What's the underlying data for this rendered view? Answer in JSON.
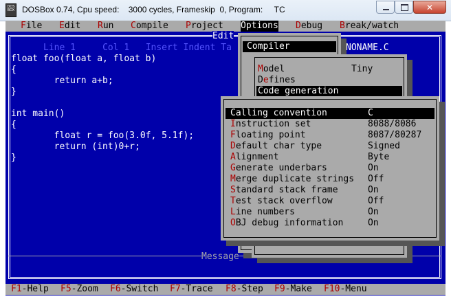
{
  "window": {
    "title": "DOSBox 0.74, Cpu speed:    3000 cycles, Frameskip  0, Program:     TC",
    "icon_label": "DOS BOX",
    "icon": "dosbox-icon"
  },
  "menubar": [
    {
      "hk": "F",
      "rest": "ile"
    },
    {
      "hk": "E",
      "rest": "dit"
    },
    {
      "hk": "R",
      "rest": "un"
    },
    {
      "hk": "C",
      "rest": "ompile"
    },
    {
      "hk": "P",
      "rest": "roject"
    },
    {
      "hk": "O",
      "rest": "ptions"
    },
    {
      "hk": "D",
      "rest": "ebug"
    },
    {
      "hk": "B",
      "rest": "reak/watch"
    }
  ],
  "editor": {
    "title": "Edit",
    "status": "Line 1     Col 1   Insert Indent Ta",
    "filename": "NONAME.C",
    "code": [
      "float foo(float a, float b)",
      "{",
      "        return a+b;",
      "}",
      "",
      "int main()",
      "{",
      "        float r = foo(3.0f, 5.1f);",
      "        return (int)0+r;",
      "}"
    ]
  },
  "message": {
    "title": "Message"
  },
  "options_menu": {
    "items": [
      {
        "label": "Compiler",
        "selected": true
      }
    ]
  },
  "compiler_menu": {
    "items": [
      {
        "hk": "M",
        "rest": "odel",
        "value": "Tiny"
      },
      {
        "hk": "",
        "lead": "D",
        "hk2": "e",
        "rest": "fines",
        "value": ""
      },
      {
        "hk": "C",
        "rest": "ode generation",
        "value": "",
        "selected": true
      }
    ]
  },
  "codegen_menu": {
    "items": [
      {
        "hk": "C",
        "rest": "alling convention",
        "value": "C",
        "selected": true
      },
      {
        "hk": "I",
        "rest": "nstruction set",
        "value": "8088/8086"
      },
      {
        "hk": "F",
        "rest": "loating point",
        "value": "8087/80287"
      },
      {
        "hk": "D",
        "rest": "efault char type",
        "value": "Signed"
      },
      {
        "hk": "A",
        "rest": "lignment",
        "value": "Byte"
      },
      {
        "hk": "G",
        "rest": "enerate underbars",
        "value": "On"
      },
      {
        "hk": "M",
        "rest": "erge duplicate strings",
        "value": "Off"
      },
      {
        "hk": "S",
        "rest": "tandard stack frame",
        "value": "On"
      },
      {
        "hk": "T",
        "rest": "est stack overflow",
        "value": "Off"
      },
      {
        "hk": "L",
        "rest": "ine numbers",
        "value": "On"
      },
      {
        "hk": "O",
        "rest": "BJ debug information",
        "value": "On"
      }
    ]
  },
  "function_keys": [
    {
      "key": "F1",
      "label": "-Help"
    },
    {
      "key": "F5",
      "label": "-Zoom"
    },
    {
      "key": "F6",
      "label": "-Switch"
    },
    {
      "key": "F7",
      "label": "-Trace"
    },
    {
      "key": "F8",
      "label": "-Step"
    },
    {
      "key": "F9",
      "label": "-Make"
    },
    {
      "key": "F10",
      "label": "-Menu"
    }
  ],
  "colors": {
    "background": "#0000aa",
    "menu": "#aaaaaa",
    "hotkey": "#aa0000",
    "text_white": "#ffffff",
    "status": "#5555ff"
  }
}
